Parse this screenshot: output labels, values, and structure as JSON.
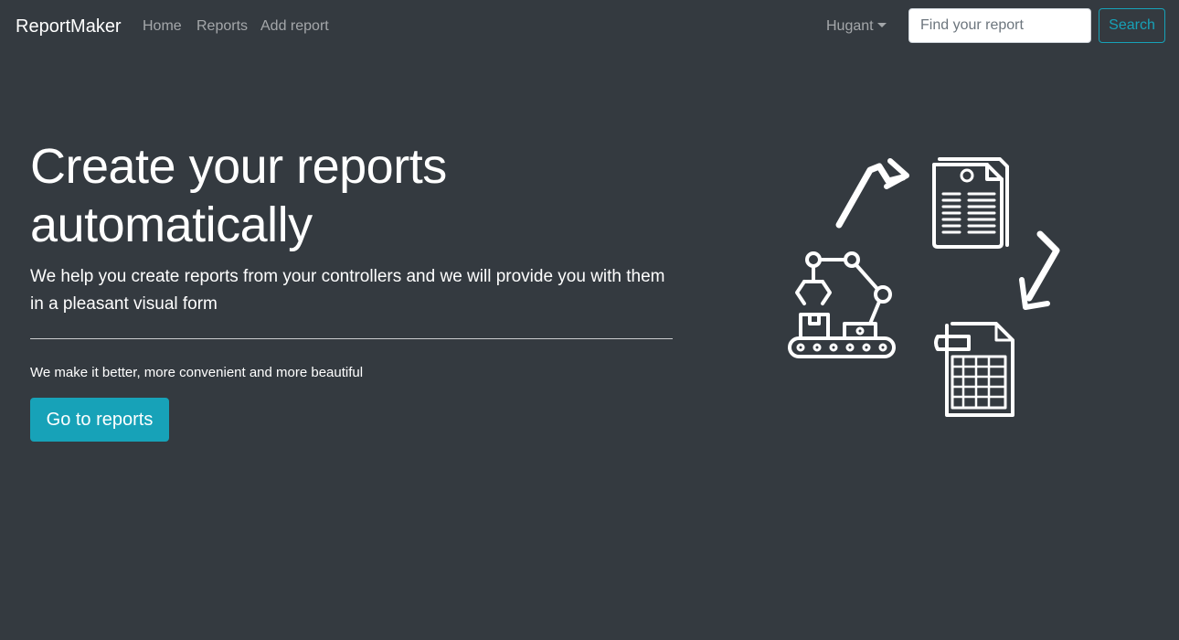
{
  "navbar": {
    "brand": "ReportMaker",
    "links": [
      {
        "label": "Home"
      },
      {
        "label": "Reports"
      },
      {
        "label": "Add report"
      }
    ],
    "user_menu": "Hugant",
    "search": {
      "placeholder": "Find your report",
      "value": "",
      "button_label": "Search"
    }
  },
  "hero": {
    "title_line1": "Create your reports",
    "title_line2": "automatically",
    "lead": "We help you create reports from your controllers and we will provide you with them in a pleasant visual form",
    "tagline": "We make it better, more convenient and more beautiful",
    "cta_label": "Go to reports"
  },
  "illustration": {
    "icons": [
      "robot-arm-conveyor-icon",
      "document-list-icon",
      "spreadsheet-file-icon",
      "arrow-up-right-icon",
      "arrow-down-left-icon"
    ]
  },
  "colors": {
    "background": "#343a40",
    "accent": "#17a2b8",
    "text": "#ffffff",
    "nav_text": "rgba(255,255,255,0.55)"
  }
}
